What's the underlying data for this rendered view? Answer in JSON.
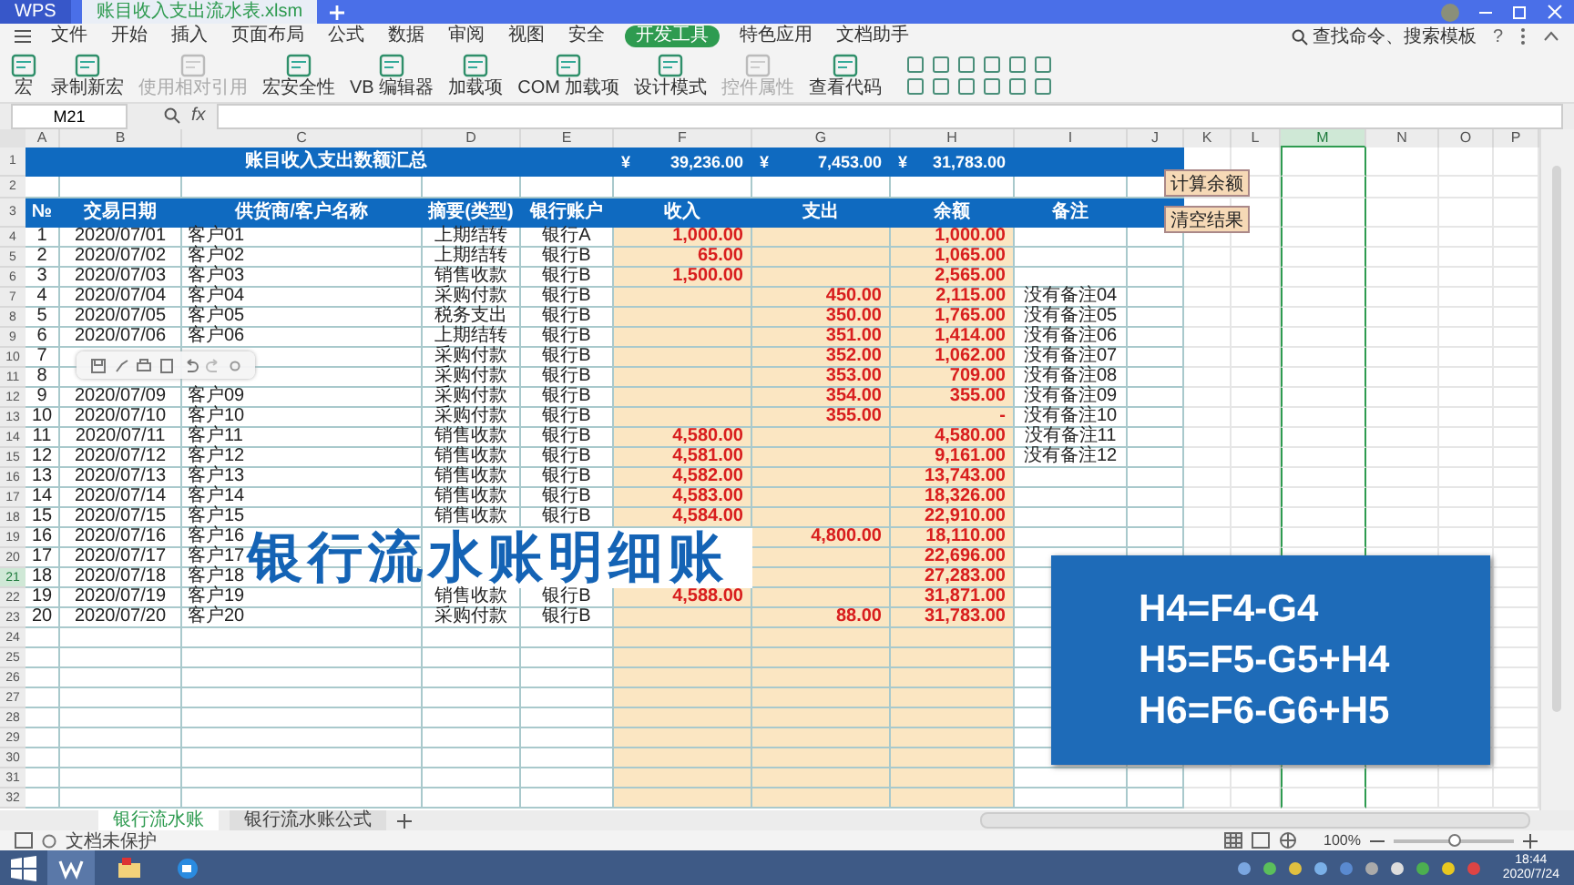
{
  "title_bar": {
    "tabs": [
      {
        "label": "WPS",
        "kind": "home",
        "selected": false
      },
      {
        "label": "账目收入支出流水表.xlsm",
        "kind": "document",
        "selected": true
      }
    ]
  },
  "menu": {
    "items": [
      {
        "label": "文件",
        "selected": false
      },
      {
        "label": "开始",
        "selected": false
      },
      {
        "label": "插入",
        "selected": false
      },
      {
        "label": "页面布局",
        "selected": false
      },
      {
        "label": "公式",
        "selected": false
      },
      {
        "label": "数据",
        "selected": false
      },
      {
        "label": "审阅",
        "selected": false
      },
      {
        "label": "视图",
        "selected": false
      },
      {
        "label": "安全",
        "selected": false
      },
      {
        "label": "开发工具",
        "selected": true
      },
      {
        "label": "特色应用",
        "selected": false
      },
      {
        "label": "文档助手",
        "selected": false
      }
    ],
    "search": "查找命令、搜索模板",
    "help": "?"
  },
  "ribbon": {
    "buttons": [
      {
        "label": "宏",
        "disabled": false
      },
      {
        "label": "录制新宏",
        "disabled": false
      },
      {
        "label": "使用相对引用",
        "disabled": true
      },
      {
        "label": "宏安全性",
        "disabled": false
      },
      {
        "label": "VB 编辑器",
        "disabled": false
      },
      {
        "label": "加载项",
        "disabled": false
      },
      {
        "label": "COM 加载项",
        "disabled": false
      },
      {
        "label": "设计模式",
        "disabled": false
      },
      {
        "label": "控件属性",
        "disabled": true
      },
      {
        "label": "查看代码",
        "disabled": false
      }
    ]
  },
  "formula_bar": {
    "cell": "M21",
    "fx": "fx"
  },
  "grid": {
    "columns": [
      {
        "letter": "A",
        "selected": false
      },
      {
        "letter": "B",
        "selected": false
      },
      {
        "letter": "C",
        "selected": false
      },
      {
        "letter": "D",
        "selected": false
      },
      {
        "letter": "E",
        "selected": false
      },
      {
        "letter": "F",
        "selected": false
      },
      {
        "letter": "G",
        "selected": false
      },
      {
        "letter": "H",
        "selected": false
      },
      {
        "letter": "I",
        "selected": false
      },
      {
        "letter": "J",
        "selected": false
      },
      {
        "letter": "K",
        "selected": false
      },
      {
        "letter": "L",
        "selected": false
      },
      {
        "letter": "M",
        "selected": true
      },
      {
        "letter": "N",
        "selected": false
      },
      {
        "letter": "O",
        "selected": false
      },
      {
        "letter": "P",
        "selected": false
      }
    ],
    "rows": [
      {
        "label": "1",
        "selected": false
      },
      {
        "label": "2",
        "selected": false
      },
      {
        "label": "3",
        "selected": false
      },
      {
        "label": "4",
        "selected": false
      },
      {
        "label": "5",
        "selected": false
      },
      {
        "label": "6",
        "selected": false
      },
      {
        "label": "7",
        "selected": false
      },
      {
        "label": "8",
        "selected": false
      },
      {
        "label": "9",
        "selected": false
      },
      {
        "label": "10",
        "selected": false
      },
      {
        "label": "11",
        "selected": false
      },
      {
        "label": "12",
        "selected": false
      },
      {
        "label": "13",
        "selected": false
      },
      {
        "label": "14",
        "selected": false
      },
      {
        "label": "15",
        "selected": false
      },
      {
        "label": "16",
        "selected": false
      },
      {
        "label": "17",
        "selected": false
      },
      {
        "label": "18",
        "selected": false
      },
      {
        "label": "19",
        "selected": false
      },
      {
        "label": "20",
        "selected": false
      },
      {
        "label": "21",
        "selected": true
      },
      {
        "label": "22",
        "selected": false
      },
      {
        "label": "23",
        "selected": false
      },
      {
        "label": "24",
        "selected": false
      },
      {
        "label": "25",
        "selected": false
      },
      {
        "label": "26",
        "selected": false
      },
      {
        "label": "27",
        "selected": false
      },
      {
        "label": "28",
        "selected": false
      },
      {
        "label": "29",
        "selected": false
      },
      {
        "label": "30",
        "selected": false
      },
      {
        "label": "31",
        "selected": false
      },
      {
        "label": "32",
        "selected": false
      }
    ]
  },
  "summary": {
    "title": "账目收入支出数额汇总",
    "totals": [
      {
        "currency": "¥",
        "amount": "39,236.00"
      },
      {
        "currency": "¥",
        "amount": "7,453.00"
      },
      {
        "currency": "¥",
        "amount": "31,783.00"
      }
    ]
  },
  "headers": [
    "№",
    "交易日期",
    "供货商/客户名称",
    "摘要(类型)",
    "银行账户",
    "收入",
    "支出",
    "余额",
    "备注"
  ],
  "records": [
    {
      "no": "1",
      "date": "2020/07/01",
      "party": "客户01",
      "type": "上期结转",
      "bank": "银行A",
      "income": "1,000.00",
      "balance": "1,000.00"
    },
    {
      "no": "2",
      "date": "2020/07/02",
      "party": "客户02",
      "type": "上期结转",
      "bank": "银行B",
      "income": "65.00",
      "balance": "1,065.00"
    },
    {
      "no": "3",
      "date": "2020/07/03",
      "party": "客户03",
      "type": "销售收款",
      "bank": "银行B",
      "income": "1,500.00",
      "balance": "2,565.00"
    },
    {
      "no": "4",
      "date": "2020/07/04",
      "party": "客户04",
      "type": "采购付款",
      "bank": "银行B",
      "expense": "450.00",
      "balance": "2,115.00",
      "note": "没有备注04"
    },
    {
      "no": "5",
      "date": "2020/07/05",
      "party": "客户05",
      "type": "税务支出",
      "bank": "银行B",
      "expense": "350.00",
      "balance": "1,765.00",
      "note": "没有备注05"
    },
    {
      "no": "6",
      "date": "2020/07/06",
      "party": "客户06",
      "type": "上期结转",
      "bank": "银行B",
      "expense": "351.00",
      "balance": "1,414.00",
      "note": "没有备注06"
    },
    {
      "no": "7",
      "type": "采购付款",
      "bank": "银行B",
      "expense": "352.00",
      "balance": "1,062.00",
      "note": "没有备注07"
    },
    {
      "no": "8",
      "type": "采购付款",
      "bank": "银行B",
      "expense": "353.00",
      "balance": "709.00",
      "note": "没有备注08"
    },
    {
      "no": "9",
      "date": "2020/07/09",
      "party": "客户09",
      "type": "采购付款",
      "bank": "银行B",
      "expense": "354.00",
      "balance": "355.00",
      "note": "没有备注09"
    },
    {
      "no": "10",
      "date": "2020/07/10",
      "party": "客户10",
      "type": "采购付款",
      "bank": "银行B",
      "expense": "355.00",
      "balance": "-",
      "note": "没有备注10"
    },
    {
      "no": "11",
      "date": "2020/07/11",
      "party": "客户11",
      "type": "销售收款",
      "bank": "银行B",
      "income": "4,580.00",
      "balance": "4,580.00",
      "note": "没有备注11"
    },
    {
      "no": "12",
      "date": "2020/07/12",
      "party": "客户12",
      "type": "销售收款",
      "bank": "银行B",
      "income": "4,581.00",
      "balance": "9,161.00",
      "note": "没有备注12"
    },
    {
      "no": "13",
      "date": "2020/07/13",
      "party": "客户13",
      "type": "销售收款",
      "bank": "银行B",
      "income": "4,582.00",
      "balance": "13,743.00"
    },
    {
      "no": "14",
      "date": "2020/07/14",
      "party": "客户14",
      "type": "销售收款",
      "bank": "银行B",
      "income": "4,583.00",
      "balance": "18,326.00"
    },
    {
      "no": "15",
      "date": "2020/07/15",
      "party": "客户15",
      "type": "销售收款",
      "bank": "银行B",
      "income": "4,584.00",
      "balance": "22,910.00"
    },
    {
      "no": "16",
      "date": "2020/07/16",
      "party": "客户16",
      "expense": "4,800.00",
      "balance": "18,110.00"
    },
    {
      "no": "17",
      "date": "2020/07/17",
      "party": "客户17",
      "balance": "22,696.00"
    },
    {
      "no": "18",
      "date": "2020/07/18",
      "party": "客户18",
      "balance": "27,283.00"
    },
    {
      "no": "19",
      "date": "2020/07/19",
      "party": "客户19",
      "type": "销售收款",
      "bank": "银行B",
      "income": "4,588.00",
      "balance": "31,871.00"
    },
    {
      "no": "20",
      "date": "2020/07/20",
      "party": "客户20",
      "type": "采购付款",
      "bank": "银行B",
      "expense": "88.00",
      "balance": "31,783.00"
    }
  ],
  "sheet_buttons": [
    "计算余额",
    "清空结果"
  ],
  "overlay": {
    "caption": "银行流水账明细账",
    "formulas": [
      "H4=F4-G4",
      "H5=F5-G5+H4",
      "H6=F6-G6+H5"
    ]
  },
  "sheet_tabs": [
    {
      "label": "银行流水账",
      "selected": true
    },
    {
      "label": "银行流水账公式",
      "selected": false
    }
  ],
  "status_bar": {
    "protection": "文档未保护",
    "zoom": "100%",
    "zoom_slider": {
      "level": 0.5
    }
  },
  "taskbar": {
    "time": "18:44",
    "date": "2020/7/24"
  }
}
